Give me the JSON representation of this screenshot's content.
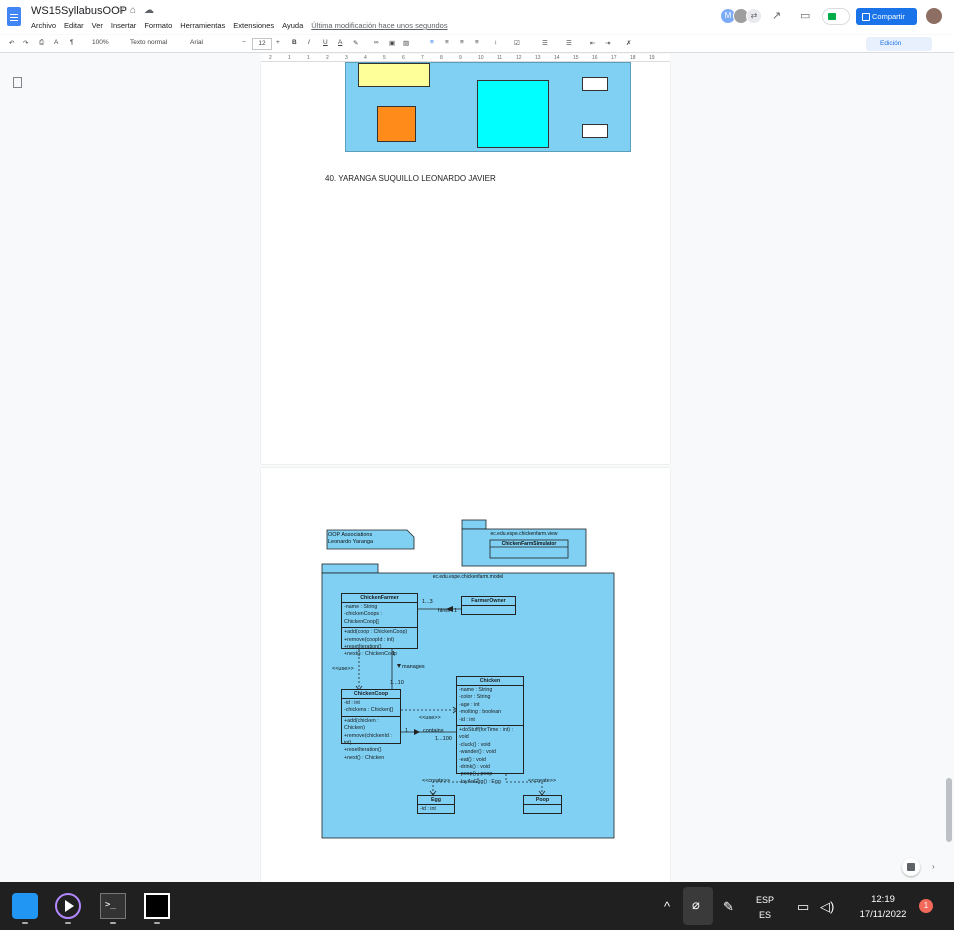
{
  "app": {
    "title": "WS15SyllabusOOP",
    "menu": [
      "Archivo",
      "Editar",
      "Ver",
      "Insertar",
      "Formato",
      "Herramientas",
      "Extensiones",
      "Ayuda"
    ],
    "last_edit": "Última modificación hace unos segundos",
    "share_label": "Compartir",
    "avatar_letter": "M"
  },
  "toolbar": {
    "zoom": "100%",
    "style": "Texto normal",
    "font": "Arial",
    "font_size": "12",
    "mode": "Edición",
    "bold": "B",
    "italic": "I",
    "underline": "U",
    "text_color": "A"
  },
  "ruler": {
    "marks": [
      "2",
      "1",
      "1",
      "2",
      "3",
      "4",
      "5",
      "6",
      "7",
      "8",
      "9",
      "10",
      "11",
      "12",
      "13",
      "14",
      "15",
      "16",
      "17",
      "18",
      "19"
    ]
  },
  "document": {
    "author_line": "40.  YARANGA SUQUILLO LEONARDO JAVIER"
  },
  "diagram": {
    "note_line1": "OOP Associations",
    "note_line2": "Leonardo Yaranga",
    "view_package": "ec.edu.espe.chickenfarm.view",
    "simulator_class": "ChickenFarmSimulator",
    "model_package": "ec.edu.espe.chickenfarm.model",
    "chicken_farmer": {
      "name": "ChickenFarmer",
      "attrs": [
        "-name : String",
        "-chickenCoops : ChickenCoop[]"
      ],
      "ops": [
        "+add(coop : ChickenCoop)",
        "+remove(coopId : int)",
        "+resetIteration()",
        "+next() : ChickenCoop"
      ]
    },
    "farmer_owner": {
      "name": "FarmerOwner"
    },
    "chicken_coop": {
      "name": "ChickenCoop",
      "attrs": [
        "-id : int",
        "-chickens : Chicken[]"
      ],
      "ops": [
        "+add(chicken : Chicken)",
        "+remove(chickenId : int)",
        "+resetIteration()",
        "+next() : Chicken"
      ]
    },
    "chicken": {
      "name": "Chicken",
      "attrs": [
        "-name : String",
        "-color : String",
        "-age : int",
        "-molting : boolean",
        "-id : int"
      ],
      "ops": [
        "+doStuff(forTime : int) : void",
        "-cluck() : void",
        "-wander() : void",
        "-eat() : void",
        "-drink() : void",
        "-poop() : poop",
        "-layAnEgg() : Egg"
      ]
    },
    "egg": {
      "name": "Egg",
      "attrs": [
        "-id : int"
      ]
    },
    "poop": {
      "name": "Poop"
    },
    "labels": {
      "mult_farmer": "1...3",
      "hires": "hires",
      "mult_owner": "1",
      "use_left": "<<use>>",
      "manages": "manages",
      "mult_manages_top": "1",
      "mult_manages_bottom": "1...10",
      "use_mid": "<<use>>",
      "contains": "contains",
      "mult_contains_left": "1",
      "mult_contains_right": "1...100",
      "create_left": "<<create>>",
      "create_right": "<<create>>"
    }
  },
  "taskbar": {
    "lang_top": "ESP",
    "lang_bottom": "ES",
    "time": "12:19",
    "date": "17/11/2022",
    "notifications": "1"
  }
}
